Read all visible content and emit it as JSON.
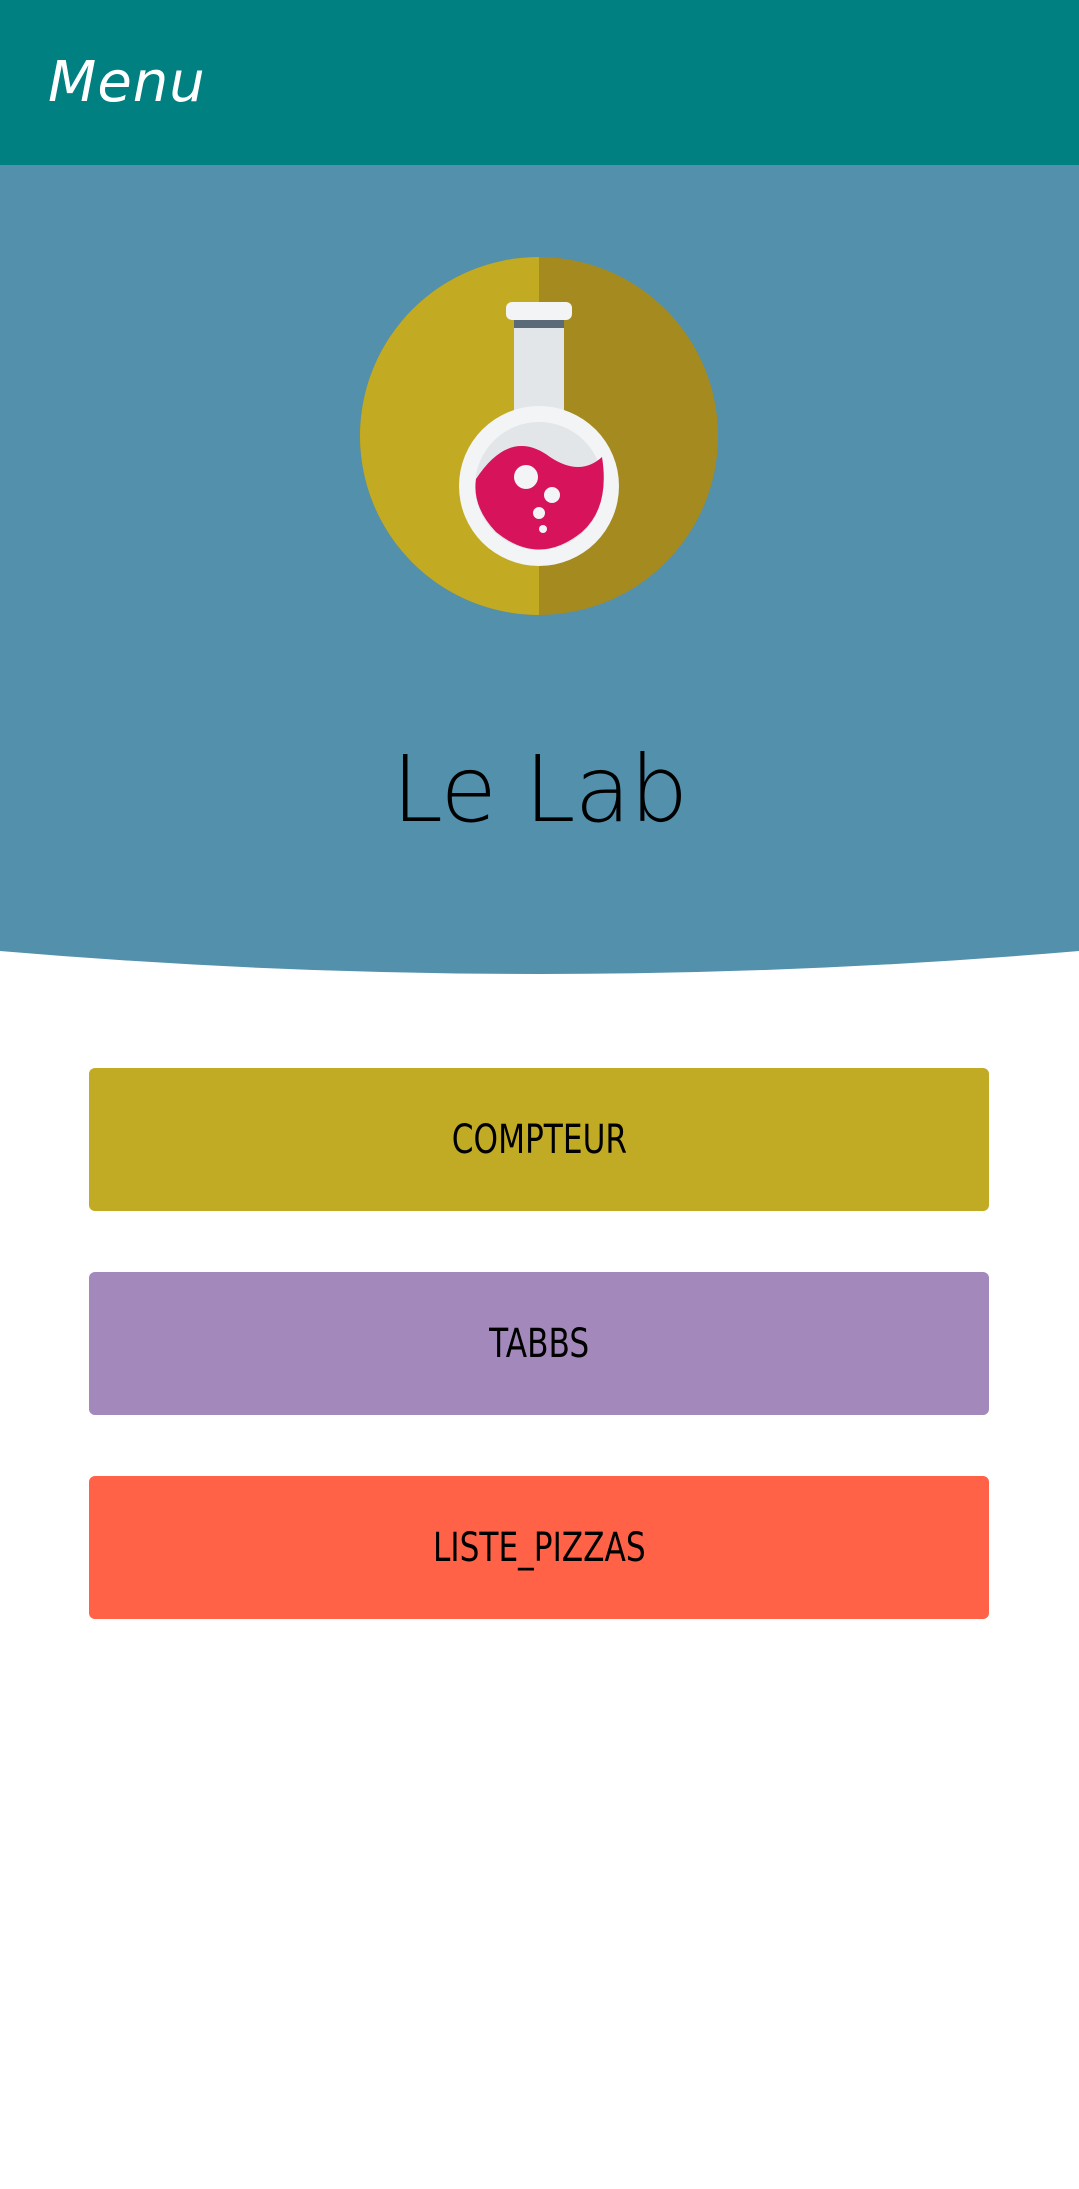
{
  "app_bar": {
    "title": "Menu",
    "color": "#008080"
  },
  "hero": {
    "title": "Le Lab",
    "background_color": "#5290AC",
    "logo_icon": "flask-icon",
    "logo_colors": {
      "circle_light": "#C2AB22",
      "circle_dark": "#A58A1F",
      "liquid": "#D6135B"
    }
  },
  "buttons": [
    {
      "label": "COMPTEUR",
      "color": "#C2AB24"
    },
    {
      "label": "TABBS",
      "color": "#A389BB"
    },
    {
      "label": "LISTE_PIZZAS",
      "color": "#FF6247"
    }
  ]
}
